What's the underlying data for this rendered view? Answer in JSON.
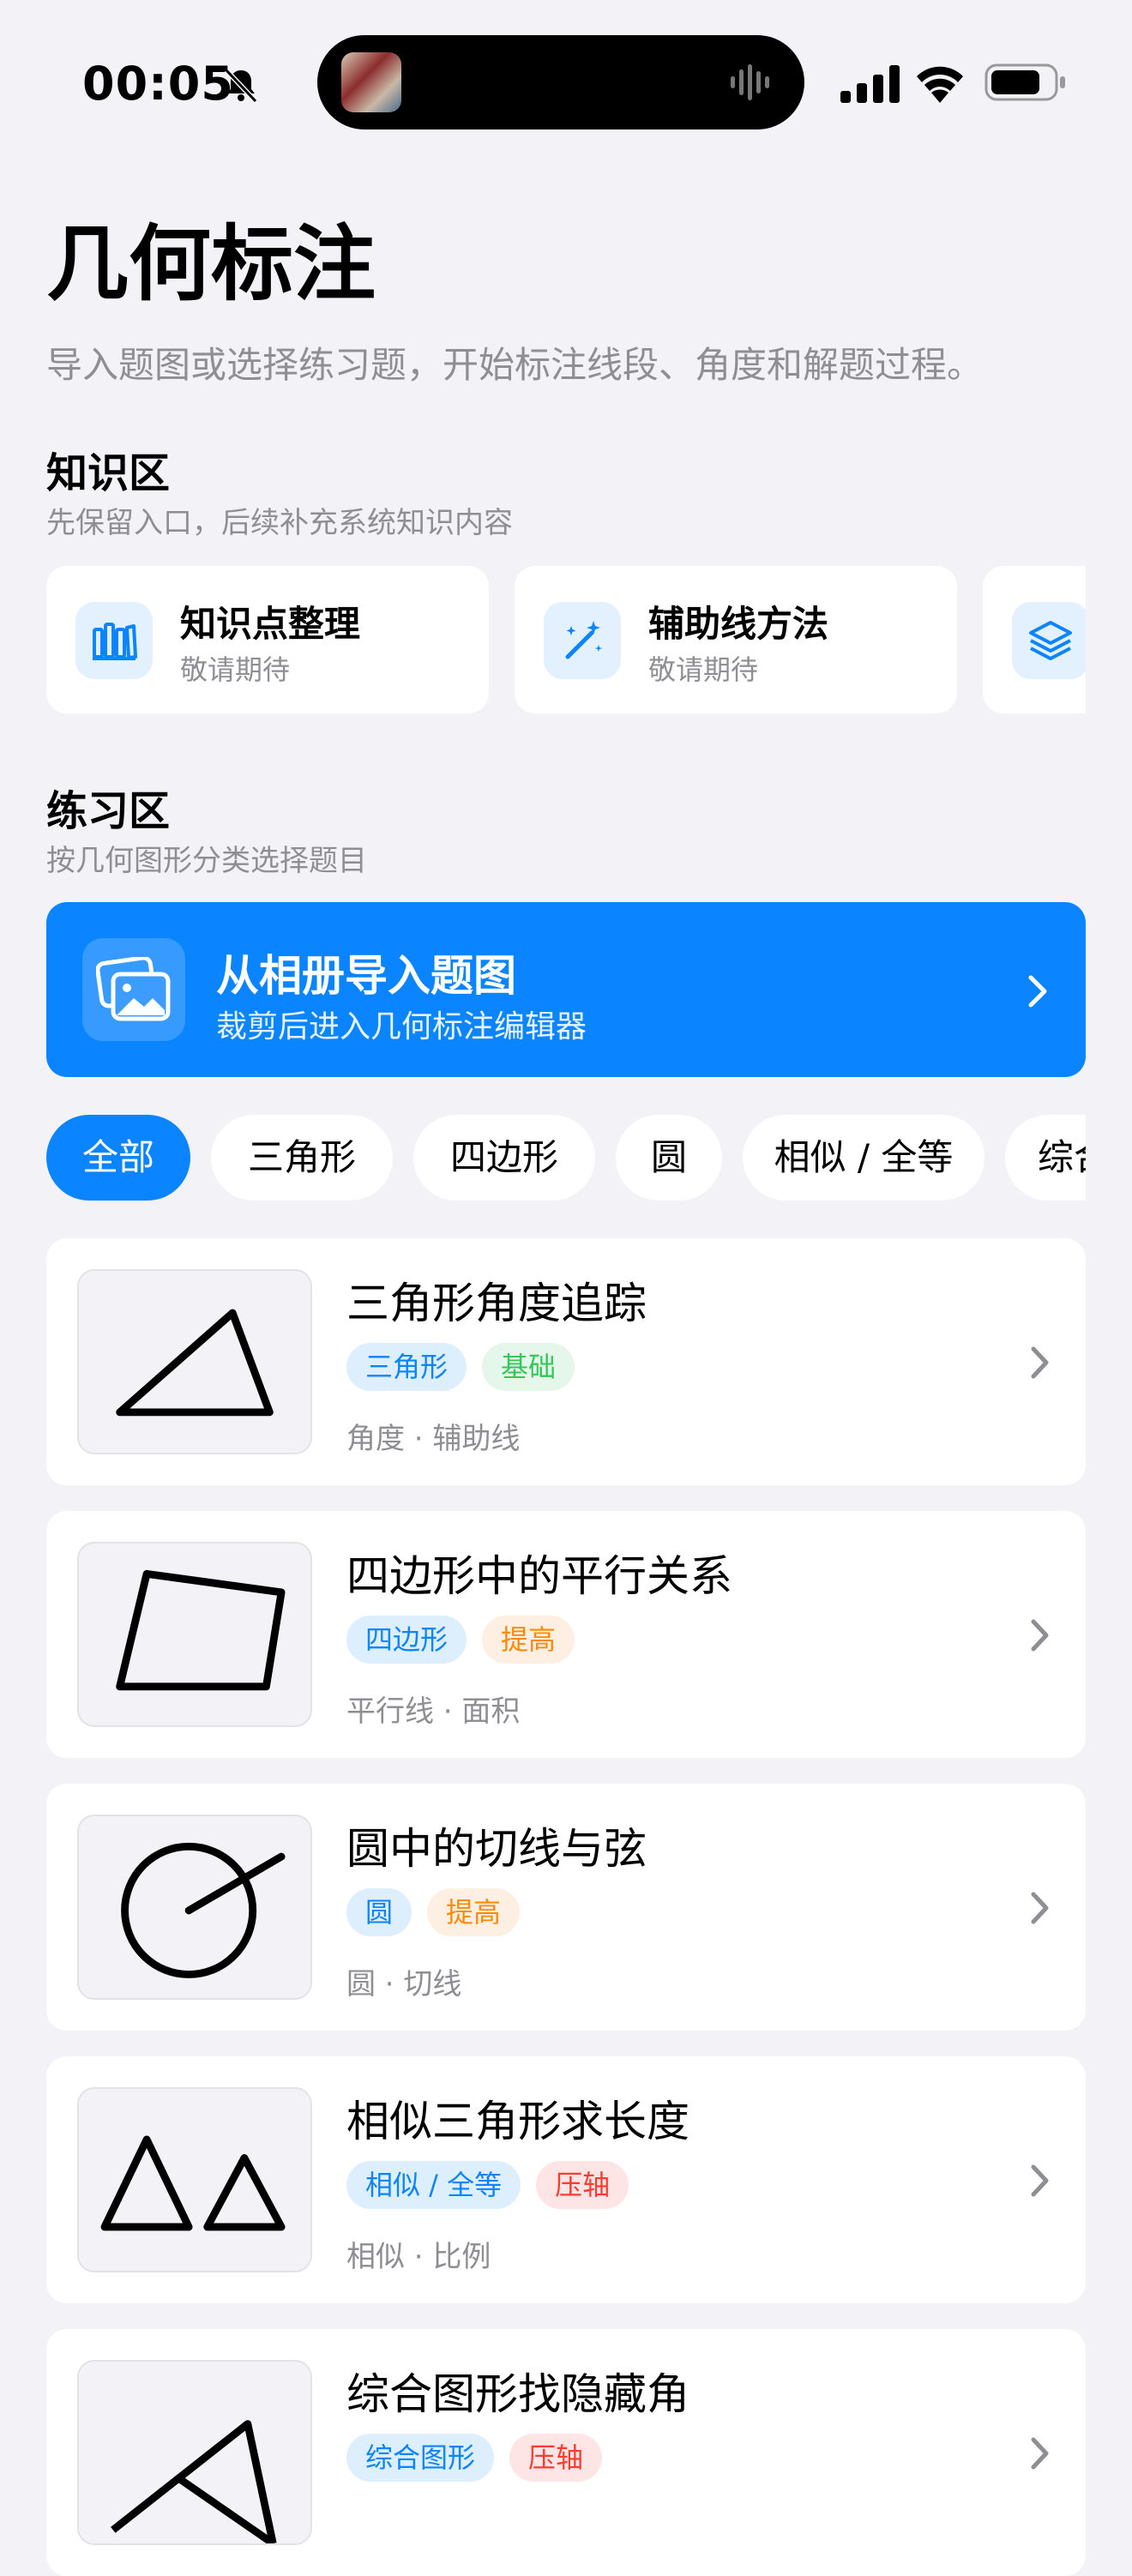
{
  "status_bar": {
    "time": "00:05"
  },
  "header": {
    "title": "几何标注",
    "subtitle": "导入题图或选择练习题，开始标注线段、角度和解题过程。"
  },
  "knowledge": {
    "title": "知识区",
    "desc": "先保留入口，后续补充系统知识内容",
    "cards": [
      {
        "title": "知识点整理",
        "sub": "敬请期待",
        "icon": "books-icon"
      },
      {
        "title": "辅助线方法",
        "sub": "敬请期待",
        "icon": "magic-wand-icon"
      },
      {
        "title": "",
        "sub": "",
        "icon": "layers-icon"
      }
    ]
  },
  "practice": {
    "title": "练习区",
    "desc": "按几何图形分类选择题目",
    "import": {
      "title": "从相册导入题图",
      "sub": "裁剪后进入几何标注编辑器",
      "icon": "photo-gallery-icon"
    },
    "chips": [
      {
        "label": "全部",
        "active": true
      },
      {
        "label": "三角形",
        "active": false
      },
      {
        "label": "四边形",
        "active": false
      },
      {
        "label": "圆",
        "active": false
      },
      {
        "label": "相似 / 全等",
        "active": false
      },
      {
        "label": "综合",
        "active": false
      }
    ],
    "exercises": [
      {
        "title": "三角形角度追踪",
        "tags": [
          {
            "text": "三角形",
            "color": "blue"
          },
          {
            "text": "基础",
            "color": "green"
          }
        ],
        "meta": "角度 · 辅助线",
        "figure": "triangle"
      },
      {
        "title": "四边形中的平行关系",
        "tags": [
          {
            "text": "四边形",
            "color": "blue"
          },
          {
            "text": "提高",
            "color": "orange"
          }
        ],
        "meta": "平行线 · 面积",
        "figure": "quadrilateral"
      },
      {
        "title": "圆中的切线与弦",
        "tags": [
          {
            "text": "圆",
            "color": "blue"
          },
          {
            "text": "提高",
            "color": "orange"
          }
        ],
        "meta": "圆 · 切线",
        "figure": "circle"
      },
      {
        "title": "相似三角形求长度",
        "tags": [
          {
            "text": "相似 / 全等",
            "color": "blue"
          },
          {
            "text": "压轴",
            "color": "red"
          }
        ],
        "meta": "相似 · 比例",
        "figure": "similar-triangles"
      },
      {
        "title": "综合图形找隐藏角",
        "tags": [
          {
            "text": "综合图形",
            "color": "blue"
          },
          {
            "text": "压轴",
            "color": "red"
          }
        ],
        "meta": "",
        "figure": "composite"
      }
    ]
  },
  "colors": {
    "accent": "#0a84ff",
    "background": "#f2f2f7",
    "secondary_text": "#8e8e93"
  }
}
